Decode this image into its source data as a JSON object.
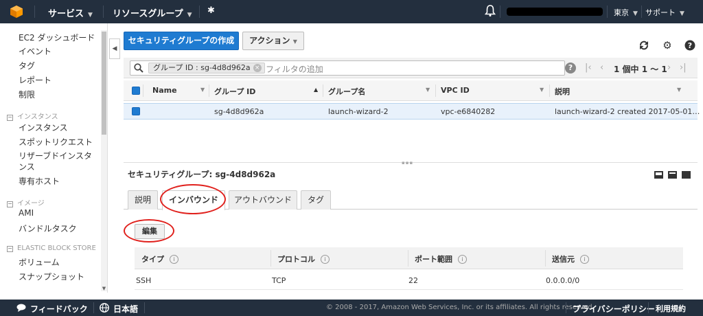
{
  "topbar": {
    "services": "サービス",
    "resource_groups": "リソースグループ",
    "region": "東京",
    "support": "サポート"
  },
  "sidebar": {
    "items_top": [
      "EC2 ダッシュボード",
      "イベント",
      "タグ",
      "レポート",
      "制限"
    ],
    "section_instances": "インスタンス",
    "instances_items": [
      "インスタンス",
      "スポットリクエスト",
      "リザーブドインスタンス",
      "専有ホスト"
    ],
    "section_images": "イメージ",
    "images_items": [
      "AMI",
      "バンドルタスク"
    ],
    "section_ebs": "ELASTIC BLOCK STORE",
    "ebs_items": [
      "ボリューム",
      "スナップショット"
    ]
  },
  "toolbar": {
    "create_button": "セキュリティグループの作成",
    "actions_button": "アクション"
  },
  "filter": {
    "chip_label": "グループ ID : sg-4d8d962a",
    "placeholder": "フィルタの追加",
    "pagination": "1 個中 1 ～ 1"
  },
  "table": {
    "headers": [
      "Name",
      "グループ ID",
      "グループ名",
      "VPC ID",
      "説明"
    ],
    "rows": [
      {
        "name": "",
        "group_id": "sg-4d8d962a",
        "group_name": "launch-wizard-2",
        "vpc_id": "vpc-e6840282",
        "description": "launch-wizard-2 created 2017-05-01…"
      }
    ]
  },
  "detail": {
    "title": "セキュリティグループ: sg-4d8d962a",
    "tabs": [
      "説明",
      "インバウンド",
      "アウトバウンド",
      "タグ"
    ],
    "active_tab": "インバウンド",
    "edit_button": "編集",
    "rules_headers": [
      "タイプ",
      "プロトコル",
      "ポート範囲",
      "送信元"
    ],
    "rules": [
      {
        "type": "SSH",
        "protocol": "TCP",
        "port": "22",
        "source": "0.0.0.0/0"
      }
    ]
  },
  "footer": {
    "feedback": "フィードバック",
    "language": "日本語",
    "copyright": "© 2008 - 2017, Amazon Web Services, Inc. or its affiliates. All rights reserved.",
    "privacy": "プライバシーポリシー",
    "terms": "利用規約"
  },
  "colors": {
    "topbar_bg": "#232f3e",
    "primary_blue": "#1f7bd1",
    "annotation_red": "#e0201c",
    "selected_row": "#e8f1fb"
  }
}
